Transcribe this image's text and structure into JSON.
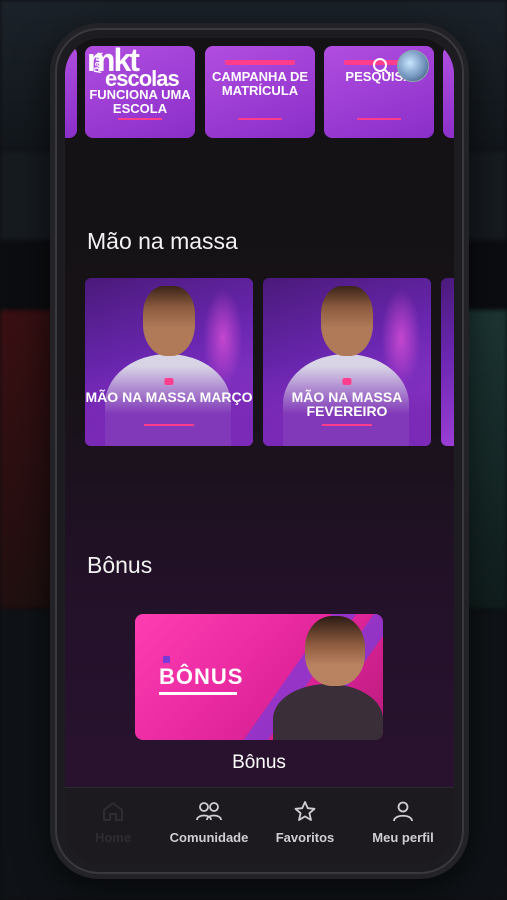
{
  "brand": {
    "line1": "mkt",
    "line2": "para",
    "line3": "escolas"
  },
  "top_row": {
    "cards": [
      {
        "title": "FUNCIONA UMA ESCOLA"
      },
      {
        "title": "CAMPANHA DE MATRÍCULA"
      },
      {
        "title": "PESQUISA"
      }
    ]
  },
  "header": {
    "search_icon": "search-icon",
    "avatar": "user-avatar"
  },
  "sections": {
    "mao_na_massa": {
      "title": "Mão na massa",
      "cards": [
        {
          "title": "MÃO NA MASSA MARÇO"
        },
        {
          "title": "MÃO NA MASSA FEVEREIRO"
        }
      ]
    },
    "bonus": {
      "title": "Bônus",
      "card_word": "BÔNUS",
      "card_label": "Bônus"
    }
  },
  "nav": {
    "items": [
      {
        "label": "Home",
        "icon": "home-icon",
        "active": true
      },
      {
        "label": "Comunidade",
        "icon": "community-icon",
        "active": false
      },
      {
        "label": "Favoritos",
        "icon": "star-icon",
        "active": false
      },
      {
        "label": "Meu perfil",
        "icon": "user-icon",
        "active": false
      }
    ]
  },
  "colors": {
    "accent": "#ff3d8d",
    "purple": "#9c3ed6",
    "nav_bg": "#1c1a1f"
  }
}
